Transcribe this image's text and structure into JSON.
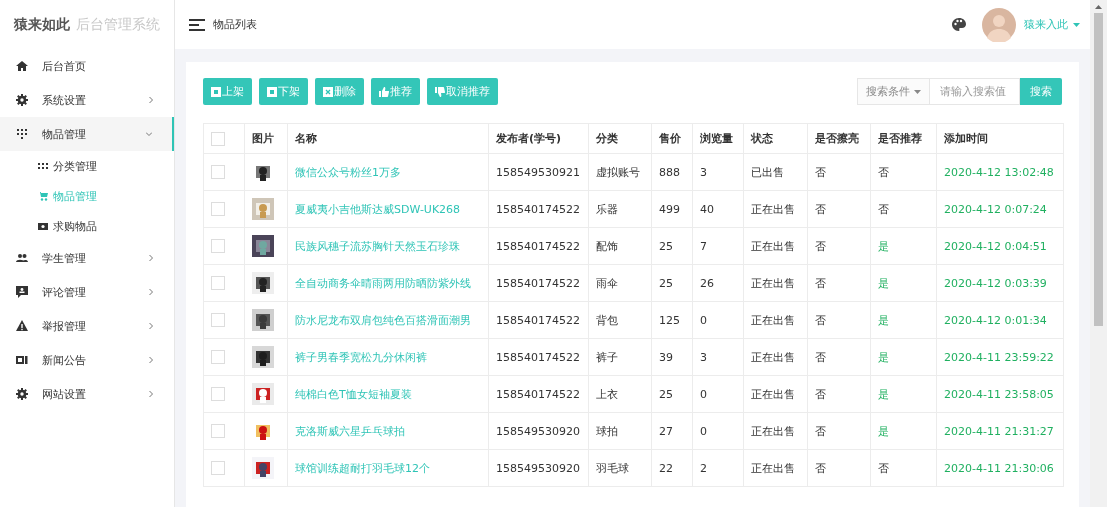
{
  "logo": {
    "brand": "猿来如此",
    "subtitle": "后台管理系统"
  },
  "header": {
    "breadcrumb": "物品列表",
    "user": "猿来入此"
  },
  "sidebar": {
    "items": [
      {
        "label": "后台首页",
        "kind": "home",
        "selected": false
      },
      {
        "label": "系统设置",
        "kind": "gear",
        "expanded": false,
        "selected": false
      },
      {
        "label": "物品管理",
        "kind": "dots",
        "expanded": true,
        "selected": true,
        "children": [
          {
            "label": "分类管理",
            "kind": "grid",
            "selected": false
          },
          {
            "label": "物品管理",
            "kind": "cart",
            "selected": true
          },
          {
            "label": "求购物品",
            "kind": "ticket",
            "selected": false
          }
        ]
      },
      {
        "label": "学生管理",
        "kind": "people",
        "expanded": false,
        "selected": false
      },
      {
        "label": "评论管理",
        "kind": "comment",
        "expanded": false,
        "selected": false
      },
      {
        "label": "举报管理",
        "kind": "warning",
        "expanded": false,
        "selected": false
      },
      {
        "label": "新闻公告",
        "kind": "news",
        "expanded": false,
        "selected": false
      },
      {
        "label": "网站设置",
        "kind": "gear",
        "expanded": false,
        "selected": false
      }
    ]
  },
  "toolbar": {
    "buttons": [
      {
        "label": "上架",
        "kind": "square"
      },
      {
        "label": "下架",
        "kind": "square"
      },
      {
        "label": "删除",
        "kind": "cross"
      },
      {
        "label": "推荐",
        "kind": "thumbsup"
      },
      {
        "label": "取消推荐",
        "kind": "thumbsdown"
      }
    ],
    "search_condition": "搜索条件",
    "search": {
      "placeholder": "请输入搜索值"
    },
    "search_button": "搜索"
  },
  "table": {
    "all_checked": false,
    "columns": [
      "图片",
      "名称",
      "发布者(学号)",
      "分类",
      "售价",
      "浏览量",
      "状态",
      "是否擦亮",
      "是否推荐",
      "添加时间"
    ],
    "rows": [
      {
        "checked": false,
        "name": "微信公众号粉丝1万多",
        "publisher": "158549530921",
        "category": "虚拟账号",
        "price": "888",
        "views": "3",
        "status": "已出售",
        "polished": "否",
        "recommended": {
          "text": "否",
          "on": false
        },
        "time": "2020-4-12 13:02:48"
      },
      {
        "checked": false,
        "name": "夏威夷小吉他斯达威SDW-UK268",
        "publisher": "158540174522",
        "category": "乐器",
        "price": "499",
        "views": "40",
        "status": "正在出售",
        "polished": "否",
        "recommended": {
          "text": "否",
          "on": false
        },
        "time": "2020-4-12 0:07:24"
      },
      {
        "checked": false,
        "name": "民族风穗子流苏胸针天然玉石珍珠",
        "publisher": "158540174522",
        "category": "配饰",
        "price": "25",
        "views": "7",
        "status": "正在出售",
        "polished": "否",
        "recommended": {
          "text": "是",
          "on": true
        },
        "time": "2020-4-12 0:04:51"
      },
      {
        "checked": false,
        "name": "全自动商务伞晴雨两用防晒防紫外线",
        "publisher": "158540174522",
        "category": "雨伞",
        "price": "25",
        "views": "26",
        "status": "正在出售",
        "polished": "否",
        "recommended": {
          "text": "是",
          "on": true
        },
        "time": "2020-4-12 0:03:39"
      },
      {
        "checked": false,
        "name": "防水尼龙布双肩包纯色百搭滑面潮男",
        "publisher": "158540174522",
        "category": "背包",
        "price": "125",
        "views": "0",
        "status": "正在出售",
        "polished": "否",
        "recommended": {
          "text": "是",
          "on": true
        },
        "time": "2020-4-12 0:01:34"
      },
      {
        "checked": false,
        "name": "裤子男春季宽松九分休闲裤",
        "publisher": "158540174522",
        "category": "裤子",
        "price": "39",
        "views": "3",
        "status": "正在出售",
        "polished": "否",
        "recommended": {
          "text": "是",
          "on": true
        },
        "time": "2020-4-11 23:59:22"
      },
      {
        "checked": false,
        "name": "纯棉白色T恤女短袖夏装",
        "publisher": "158540174522",
        "category": "上衣",
        "price": "25",
        "views": "0",
        "status": "正在出售",
        "polished": "否",
        "recommended": {
          "text": "是",
          "on": true
        },
        "time": "2020-4-11 23:58:05"
      },
      {
        "checked": false,
        "name": "克洛斯威六星乒乓球拍",
        "publisher": "158549530920",
        "category": "球拍",
        "price": "27",
        "views": "0",
        "status": "正在出售",
        "polished": "否",
        "recommended": {
          "text": "是",
          "on": true
        },
        "time": "2020-4-11 21:31:27"
      },
      {
        "checked": false,
        "name": "球馆训练超耐打羽毛球12个",
        "publisher": "158549530920",
        "category": "羽毛球",
        "price": "22",
        "views": "2",
        "status": "正在出售",
        "polished": "否",
        "recommended": {
          "text": "否",
          "on": false
        },
        "time": "2020-4-11 21:30:06"
      }
    ]
  }
}
